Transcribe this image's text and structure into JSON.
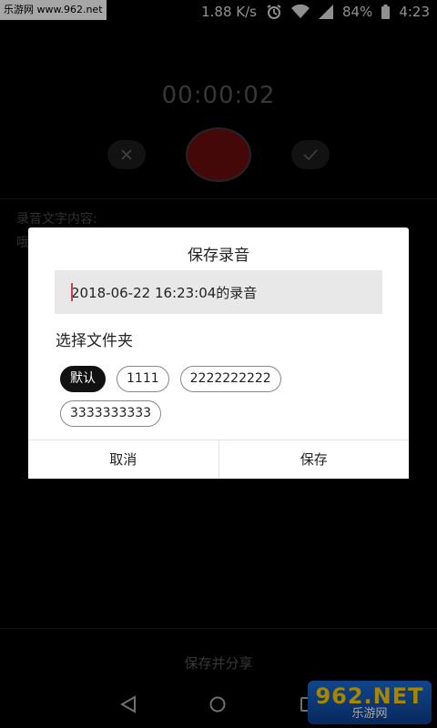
{
  "watermark_top": "乐游网 www.962.net",
  "status": {
    "speed": "1.88 K/s",
    "battery": "84%",
    "time": "4:23"
  },
  "recorder": {
    "timer": "00:00:02",
    "content_label": "录音文字内容:",
    "content_text": "哦",
    "share_label": "保存并分享"
  },
  "dialog": {
    "title": "保存录音",
    "name_value": "2018-06-22 16:23:04的录音",
    "folder_label": "选择文件夹",
    "folders": [
      "默认",
      "1111",
      "2222222222",
      "3333333333"
    ],
    "selected_folder": "默认",
    "cancel_label": "取消",
    "save_label": "保存"
  },
  "watermark_bottom": {
    "brand": "962.NET",
    "sub": "乐游网"
  },
  "icons": {
    "cancel": "close-icon",
    "confirm": "check-icon",
    "record": "record-icon",
    "back": "back-triangle-icon",
    "home": "home-circle-icon",
    "recent": "recent-square-icon"
  },
  "colors": {
    "record": "#6b0d0d",
    "selected_chip": "#111111",
    "caret": "#d23a5a"
  }
}
